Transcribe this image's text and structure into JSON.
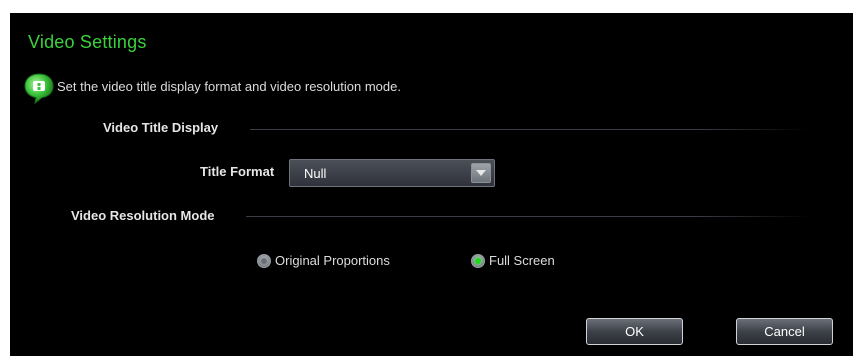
{
  "dialog": {
    "title": "Video Settings",
    "info_icon": "speech-bubble-info-icon",
    "info_text": "Set the video title display format and video resolution mode.",
    "accent_color": "#3bd13b"
  },
  "sections": {
    "title_display": {
      "label": "Video Title Display"
    },
    "resolution_mode": {
      "label": "Video Resolution Mode"
    }
  },
  "title_format": {
    "label": "Title Format",
    "selected": "Null"
  },
  "resolution": {
    "options": [
      {
        "label": "Original Proportions",
        "checked": false
      },
      {
        "label": "Full Screen",
        "checked": true
      }
    ]
  },
  "buttons": {
    "ok": "OK",
    "cancel": "Cancel"
  }
}
